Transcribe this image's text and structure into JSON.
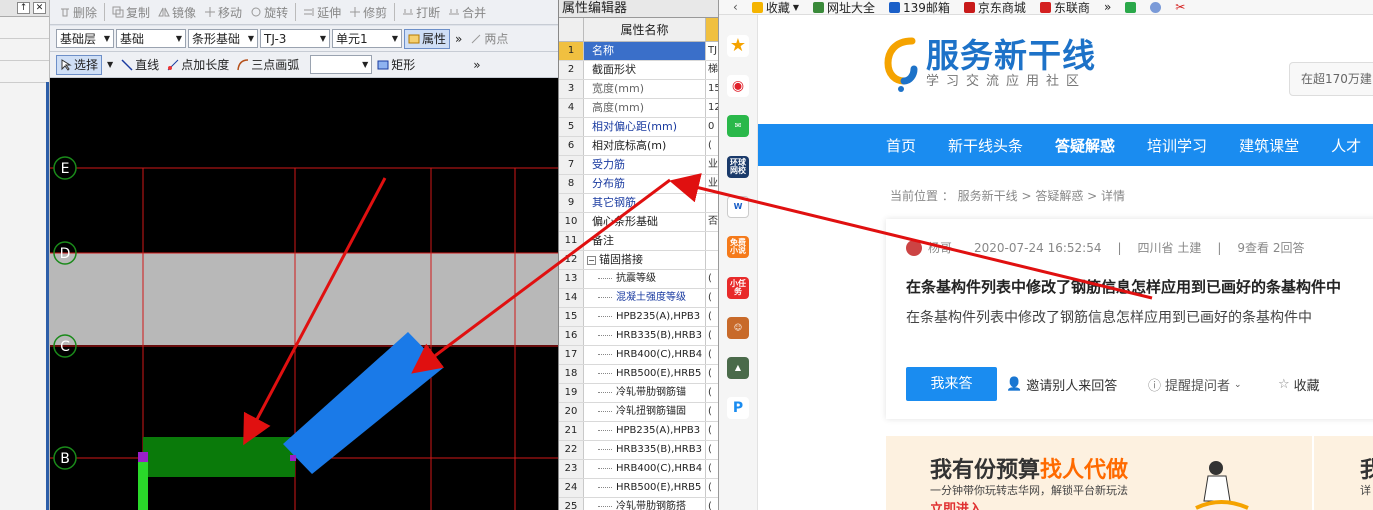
{
  "left_panel": {
    "pin": "↑",
    "close": "✕"
  },
  "toolbar1": {
    "delete": "删除",
    "copy": "复制",
    "mirror": "镜像",
    "move": "移动",
    "rotate": "旋转",
    "extend": "延伸",
    "trim": "修剪",
    "break": "打断",
    "merge": "合并"
  },
  "toolbar2": {
    "layer": "基础层",
    "category": "基础",
    "type": "条形基础",
    "component": "TJ-3",
    "unit": "单元1",
    "properties": "属性",
    "two_points": "两点"
  },
  "toolbar3": {
    "select": "选择",
    "line": "直线",
    "point_length": "点加长度",
    "arc": "三点画弧",
    "rect": "矩形"
  },
  "grid_labels": [
    "E",
    "D",
    "C",
    "B"
  ],
  "property_editor": {
    "title": "属性编辑器",
    "col_name": "属性名称",
    "rows": [
      {
        "n": "1",
        "name": "名称",
        "val": "TJ"
      },
      {
        "n": "2",
        "name": "截面形状",
        "val": "梯"
      },
      {
        "n": "3",
        "name": "宽度(mm)",
        "val": "15"
      },
      {
        "n": "4",
        "name": "高度(mm)",
        "val": "12"
      },
      {
        "n": "5",
        "name": "相对偏心距(mm)",
        "val": "0"
      },
      {
        "n": "6",
        "name": "相对底标高(m)",
        "val": "("
      },
      {
        "n": "7",
        "name": "受力筋",
        "val": "业"
      },
      {
        "n": "8",
        "name": "分布筋",
        "val": "业"
      },
      {
        "n": "9",
        "name": "其它钢筋",
        "val": ""
      },
      {
        "n": "10",
        "name": "偏心条形基础",
        "val": "否"
      },
      {
        "n": "11",
        "name": "备注",
        "val": ""
      },
      {
        "n": "12",
        "name": "锚固搭接",
        "val": ""
      },
      {
        "n": "13",
        "name": "抗震等级",
        "val": "("
      },
      {
        "n": "14",
        "name": "混凝土强度等级",
        "val": "("
      },
      {
        "n": "15",
        "name": "HPB235(A),HPB3",
        "val": "("
      },
      {
        "n": "16",
        "name": "HRB335(B),HRB3",
        "val": "("
      },
      {
        "n": "17",
        "name": "HRB400(C),HRB4",
        "val": "("
      },
      {
        "n": "18",
        "name": "HRB500(E),HRB5",
        "val": "("
      },
      {
        "n": "19",
        "name": "冷轧带肋钢筋锚",
        "val": "("
      },
      {
        "n": "20",
        "name": "冷轧扭钢筋锚固",
        "val": "("
      },
      {
        "n": "21",
        "name": "HPB235(A),HPB3",
        "val": "("
      },
      {
        "n": "22",
        "name": "HRB335(B),HRB3",
        "val": "("
      },
      {
        "n": "23",
        "name": "HRB400(C),HRB4",
        "val": "("
      },
      {
        "n": "24",
        "name": "HRB500(E),HRB5",
        "val": "("
      },
      {
        "n": "25",
        "name": "冷轧带肋钢筋搭",
        "val": "("
      }
    ]
  },
  "browser": {
    "bookmarks": [
      "收藏",
      "网址大全",
      "139邮箱",
      "京东商城",
      "东联商"
    ],
    "bookmark_more": "»",
    "sidebar": {
      "news": "环球\n网校",
      "novel": "免费\n小说",
      "task": "小任务"
    },
    "logo_title": "服务新干线",
    "logo_sub": "学习交流应用社区",
    "search_placeholder": "在超170万建",
    "nav": [
      "首页",
      "新干线头条",
      "答疑解惑",
      "培训学习",
      "建筑课堂",
      "人才"
    ],
    "breadcrumb": "当前位置 ： 服务新干线 > 答疑解惑 > 详情",
    "question": {
      "user": "杨哥",
      "date": "2020-07-24 16:52:54",
      "location": "四川省  土建",
      "stats": "9查看  2回答",
      "title": "在条基构件列表中修改了钢筋信息怎样应用到已画好的条基构件中",
      "body": "在条基构件列表中修改了钢筋信息怎样应用到已画好的条基构件中",
      "answer_btn": "我来答",
      "invite": "邀请别人来回答",
      "remind": "提醒提问者",
      "favorite": "收藏"
    },
    "banner": {
      "line1a": "我有份预算",
      "line1b": "找人代做",
      "line2": "一分钟带你玩转志华网，解锁平台新玩法",
      "line3": "立即进入",
      "right1": "我",
      "right2": "详"
    }
  },
  "colors": {
    "grid": "#d01818",
    "footing_green": "#0a7a0a",
    "footing_blue": "#1a7ae8",
    "arrow": "#e01010",
    "nav_blue": "#1a8cf0"
  }
}
